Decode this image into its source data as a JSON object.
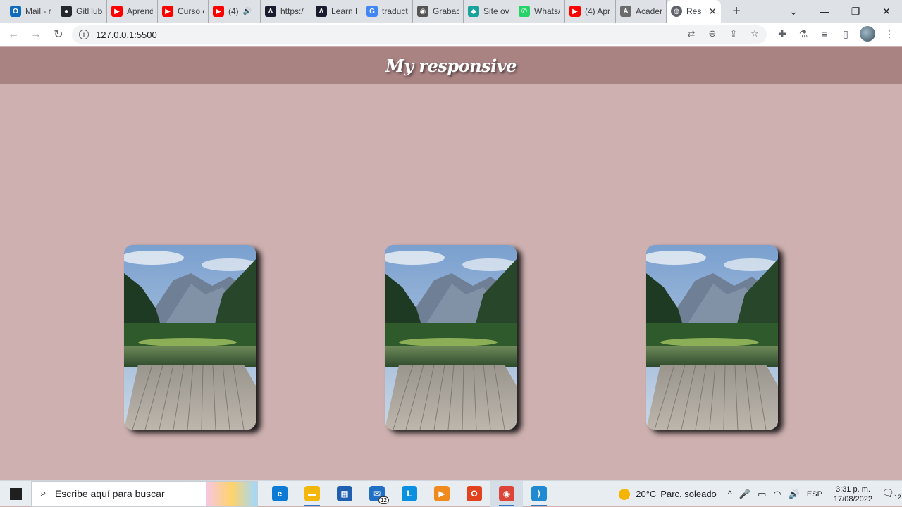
{
  "browser": {
    "tabs": [
      {
        "label": "Mail - r",
        "icon": "outlook-icon",
        "color": "#0f6cbd",
        "glyph": "O"
      },
      {
        "label": "GitHub",
        "icon": "github-icon",
        "color": "#24292f",
        "glyph": "●"
      },
      {
        "label": "Aprend",
        "icon": "youtube-icon",
        "color": "#ff0000",
        "glyph": "▶"
      },
      {
        "label": "Curso c",
        "icon": "youtube-icon",
        "color": "#ff0000",
        "glyph": "▶"
      },
      {
        "label": "(4)",
        "icon": "youtube-icon",
        "color": "#ff0000",
        "glyph": "▶",
        "audio": "🔊"
      },
      {
        "label": "https:/",
        "icon": "codely-icon",
        "color": "#1b1b2f",
        "glyph": "Λ"
      },
      {
        "label": "Learn E",
        "icon": "codely-icon",
        "color": "#1b1b2f",
        "glyph": "Λ"
      },
      {
        "label": "traduct",
        "icon": "google-icon",
        "color": "#4285f4",
        "glyph": "G"
      },
      {
        "label": "Grabac",
        "icon": "camera-icon",
        "color": "#555555",
        "glyph": "◉"
      },
      {
        "label": "Site ov",
        "icon": "diamond-icon",
        "color": "#1aa39a",
        "glyph": "◆"
      },
      {
        "label": "Whats/",
        "icon": "whatsapp-icon",
        "color": "#25d366",
        "glyph": "✆"
      },
      {
        "label": "(4) Apr",
        "icon": "youtube-icon",
        "color": "#ff0000",
        "glyph": "▶"
      },
      {
        "label": "Acader",
        "icon": "academy-icon",
        "color": "#6b6b6b",
        "glyph": "A"
      }
    ],
    "active_tab": {
      "label": "Res",
      "icon": "globe-icon",
      "close": "✕"
    },
    "new_tab": "+",
    "window_controls": {
      "dropdown": "⌄",
      "minimize": "—",
      "restore": "❐",
      "close": "✕"
    },
    "nav": {
      "back": "←",
      "forward": "→",
      "reload": "↻"
    },
    "address": {
      "info": "i",
      "url": "127.0.0.1:5500"
    },
    "omnibox_icons": [
      {
        "name": "translate-icon",
        "glyph": "⇄"
      },
      {
        "name": "zoom-icon",
        "glyph": "⊖"
      },
      {
        "name": "share-icon",
        "glyph": "⇪"
      },
      {
        "name": "star-icon",
        "glyph": "☆"
      }
    ],
    "toolbar_icons": [
      {
        "name": "extensions-icon",
        "glyph": "✚"
      },
      {
        "name": "lab-icon",
        "glyph": "⚗"
      },
      {
        "name": "reading-list-icon",
        "glyph": "≡"
      },
      {
        "name": "side-panel-icon",
        "glyph": "▯"
      }
    ],
    "menu": "⋮"
  },
  "page": {
    "title": "My responsive",
    "cards": [
      {
        "name": "landscape-card-1"
      },
      {
        "name": "landscape-card-2"
      },
      {
        "name": "landscape-card-3"
      }
    ],
    "colors": {
      "background": "#ceb0b0",
      "header": "#a98282",
      "title": "#ffffff"
    }
  },
  "taskbar": {
    "search_placeholder": "Escribe aquí para buscar",
    "apps": [
      {
        "name": "edge-icon",
        "color": "#0c7bd6",
        "glyph": "e",
        "open": false
      },
      {
        "name": "file-explorer-icon",
        "color": "#f2b70a",
        "glyph": "▬",
        "open": true
      },
      {
        "name": "store-icon",
        "color": "#1f5fb0",
        "glyph": "▦",
        "open": false
      },
      {
        "name": "mail-icon",
        "color": "#2170c6",
        "glyph": "✉",
        "open": false,
        "badge": "12"
      },
      {
        "name": "l-app-icon",
        "color": "#0b8fe0",
        "glyph": "L",
        "open": false
      },
      {
        "name": "presentation-icon",
        "color": "#f08a1c",
        "glyph": "▶",
        "open": false
      },
      {
        "name": "office-icon",
        "color": "#e3421f",
        "glyph": "O",
        "open": false
      },
      {
        "name": "chrome-icon",
        "color": "#db4437",
        "glyph": "◉",
        "open": true,
        "active": true
      },
      {
        "name": "vscode-icon",
        "color": "#1f8ad2",
        "glyph": "⟩",
        "open": true
      }
    ],
    "weather": {
      "temp": "20°C",
      "label": "Parc. soleado"
    },
    "tray_symbols": [
      "^",
      "🎤",
      "▭",
      "◠",
      "🔊"
    ],
    "language": "ESP",
    "time": "3:31 p. m.",
    "date": "17/08/2022",
    "notifications": "12"
  }
}
